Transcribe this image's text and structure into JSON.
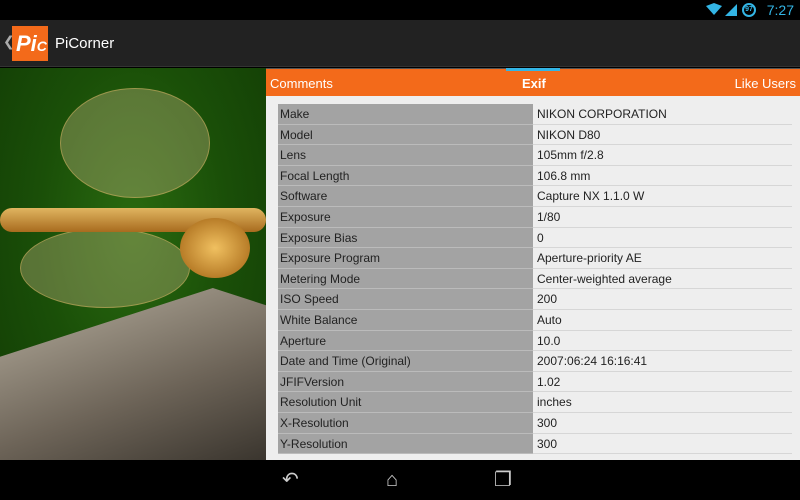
{
  "status": {
    "time": "7:27",
    "battery": "97"
  },
  "app": {
    "title": "PiCorner",
    "logo_text": "PiC"
  },
  "tabs": [
    {
      "label": "Comments"
    },
    {
      "label": "Exif",
      "selected": true
    },
    {
      "label": "Like Users"
    }
  ],
  "exif": [
    {
      "k": "Make",
      "v": "NIKON CORPORATION"
    },
    {
      "k": "Model",
      "v": "NIKON D80"
    },
    {
      "k": "Lens",
      "v": "105mm f/2.8"
    },
    {
      "k": "Focal Length",
      "v": "106.8 mm"
    },
    {
      "k": "Software",
      "v": "Capture NX 1.1.0 W"
    },
    {
      "k": "Exposure",
      "v": "1/80"
    },
    {
      "k": "Exposure Bias",
      "v": "0"
    },
    {
      "k": "Exposure Program",
      "v": "Aperture-priority AE"
    },
    {
      "k": "Metering Mode",
      "v": "Center-weighted average"
    },
    {
      "k": "ISO Speed",
      "v": "200"
    },
    {
      "k": "White Balance",
      "v": "Auto"
    },
    {
      "k": "Aperture",
      "v": "10.0"
    },
    {
      "k": "Date and Time (Original)",
      "v": "2007:06:24 16:16:41"
    },
    {
      "k": "JFIFVersion",
      "v": "1.02"
    },
    {
      "k": "Resolution Unit",
      "v": "inches"
    },
    {
      "k": "X-Resolution",
      "v": "300"
    },
    {
      "k": "Y-Resolution",
      "v": "300"
    }
  ]
}
